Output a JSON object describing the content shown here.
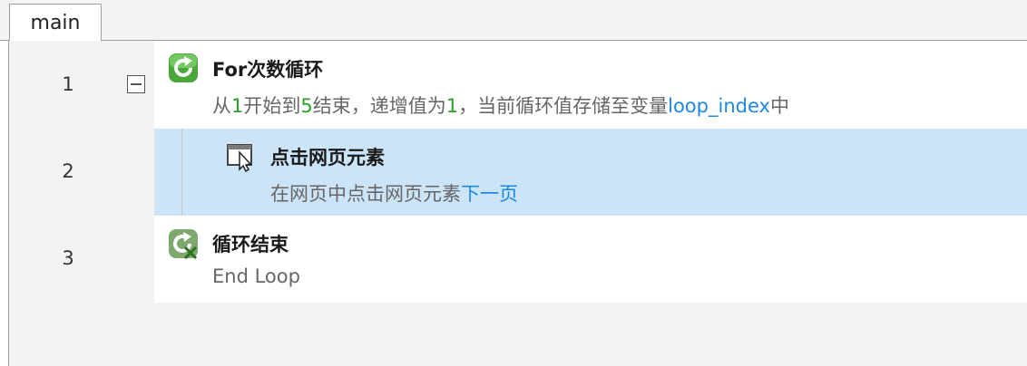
{
  "tabs": [
    {
      "label": "main",
      "active": true
    }
  ],
  "lines": [
    {
      "number": "1",
      "collapsible": true,
      "icon": "loop-refresh-icon",
      "title": "For次数循环",
      "desc": {
        "p1": "从",
        "start": "1",
        "p2": "开始到",
        "end": "5",
        "p3": "结束，递增值为",
        "step": "1",
        "p4": "，当前循环值存储至变量",
        "var": "loop_index",
        "p5": "中"
      }
    },
    {
      "number": "2",
      "selected": true,
      "icon": "click-element-icon",
      "title": "点击网页元素",
      "desc": {
        "p1": "在网页中点击网页元素",
        "target": "下一页"
      }
    },
    {
      "number": "3",
      "icon": "loop-end-icon",
      "title": "循环结束",
      "desc": {
        "p1": "End Loop"
      }
    }
  ],
  "colors": {
    "selected_row": "#cce4f7",
    "number_literal": "#2ca02c",
    "variable_link": "#1e88e5",
    "icon_green": "#3f9f2f"
  }
}
